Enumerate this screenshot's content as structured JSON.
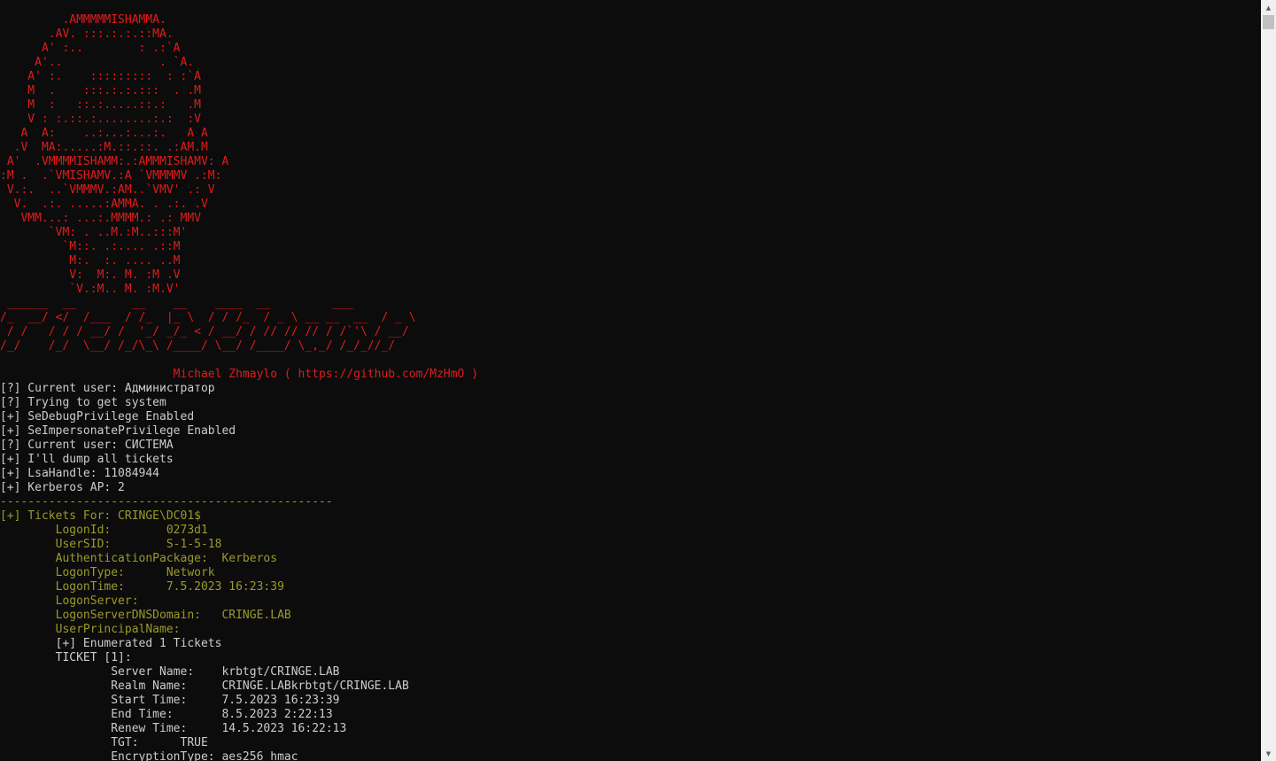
{
  "colors": {
    "background": "#0c0c0c",
    "banner_red": "#e21b1b",
    "text_gray": "#cccccc",
    "text_olive": "#9a9a2a"
  },
  "icons": {
    "scroll_up": "scroll-up-arrow-icon",
    "scroll_down": "scroll-down-arrow-icon"
  },
  "console": {
    "lines": [
      {
        "text": "         .AMMMMMISHAMMA.",
        "color": "red"
      },
      {
        "text": "       .AV. :::.:.:.::MA.",
        "color": "red"
      },
      {
        "text": "      A' :..        : .:`A",
        "color": "red"
      },
      {
        "text": "     A'..              . `A.",
        "color": "red"
      },
      {
        "text": "    A' :.    :::::::::  : :`A",
        "color": "red"
      },
      {
        "text": "    M  .    :::.:.:.:::  . .M",
        "color": "red"
      },
      {
        "text": "    M  :   ::.:.....::.:   .M",
        "color": "red"
      },
      {
        "text": "    V : :.::.:........:.:  :V",
        "color": "red"
      },
      {
        "text": "   A  A:    ..:...:...:.   A A",
        "color": "red"
      },
      {
        "text": "  .V  MA:.....:M.::.::. .:AM.M",
        "color": "red"
      },
      {
        "text": " A'  .VMMMMISHAMM:.:AMMMISHAMV: A",
        "color": "red"
      },
      {
        "text": ":M .  .`VMISHAMV.:A `VMMMMV .:M:",
        "color": "red"
      },
      {
        "text": " V.:.  ..`VMMMV.:AM..`VMV' .: V",
        "color": "red"
      },
      {
        "text": "  V.  .:. .....:AMMA. . .:. .V",
        "color": "red"
      },
      {
        "text": "   VMM...: ...:.MMMM.: .: MMV",
        "color": "red"
      },
      {
        "text": "       `VM: . ..M.:M..:::M'",
        "color": "red"
      },
      {
        "text": "         `M::. .:.... .::M",
        "color": "red"
      },
      {
        "text": "          M:.  :. .... ..M",
        "color": "red"
      },
      {
        "text": "          V:  M:. M. :M .V",
        "color": "red"
      },
      {
        "text": "          `V.:M.. M. :M.V'",
        "color": "red"
      },
      {
        "text": " ______  __        __    __    ____  __         ___",
        "color": "red"
      },
      {
        "text": "/_  __/ </  /___  / /_  |_ \\  / / /_  / _ \\ __ __  __  / _ \\",
        "color": "red"
      },
      {
        "text": " / /   / / / __/ /  '_/ _/_ < / __/ / // // // / /`'\\ / __/",
        "color": "red"
      },
      {
        "text": "/_/    /_/  \\__/ /_/\\_\\ /____/ \\__/ /____/ \\_,_/ /_/_//_/",
        "color": "red"
      },
      {
        "text": "",
        "color": "red"
      },
      {
        "text": "                         Michael Zhmaylo ( https://github.com/MzHmO )",
        "color": "red"
      },
      {
        "text": "[?] Current user: Администратор",
        "color": "gray"
      },
      {
        "text": "[?] Trying to get system",
        "color": "gray"
      },
      {
        "text": "[+] SeDebugPrivilege Enabled",
        "color": "gray"
      },
      {
        "text": "[+] SeImpersonatePrivilege Enabled",
        "color": "gray"
      },
      {
        "text": "[?] Current user: СИСТЕМА",
        "color": "gray"
      },
      {
        "text": "[+] I'll dump all tickets",
        "color": "gray"
      },
      {
        "text": "[+] LsaHandle: 11084944",
        "color": "gray"
      },
      {
        "text": "[+] Kerberos AP: 2",
        "color": "gray"
      },
      {
        "text": "------------------------------------------------",
        "color": "olive"
      },
      {
        "text": "[+] Tickets For: CRINGE\\DC01$",
        "color": "olive"
      },
      {
        "text": "        LogonId:        0273d1",
        "color": "olive"
      },
      {
        "text": "        UserSID:        S-1-5-18",
        "color": "olive"
      },
      {
        "text": "        AuthenticationPackage:  Kerberos",
        "color": "olive"
      },
      {
        "text": "        LogonType:      Network",
        "color": "olive"
      },
      {
        "text": "        LogonTime:      7.5.2023 16:23:39",
        "color": "olive"
      },
      {
        "text": "        LogonServer:",
        "color": "olive"
      },
      {
        "text": "        LogonServerDNSDomain:   CRINGE.LAB",
        "color": "olive"
      },
      {
        "text": "        UserPrincipalName:",
        "color": "olive"
      },
      {
        "text": "        [+] Enumerated 1 Tickets",
        "color": "gray"
      },
      {
        "text": "        TICKET [1]:",
        "color": "gray"
      },
      {
        "text": "                Server Name:    krbtgt/CRINGE.LAB",
        "color": "gray"
      },
      {
        "text": "                Realm Name:     CRINGE.LABkrbtgt/CRINGE.LAB",
        "color": "gray"
      },
      {
        "text": "                Start Time:     7.5.2023 16:23:39",
        "color": "gray"
      },
      {
        "text": "                End Time:       8.5.2023 2:22:13",
        "color": "gray"
      },
      {
        "text": "                Renew Time:     14.5.2023 16:22:13",
        "color": "gray"
      },
      {
        "text": "                TGT:      TRUE",
        "color": "gray"
      },
      {
        "text": "                EncryptionType: aes256_hmac",
        "color": "gray"
      }
    ]
  }
}
